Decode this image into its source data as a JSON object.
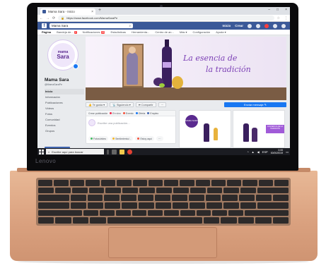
{
  "laptop": {
    "brand": "Lenovo"
  },
  "browser": {
    "tab_title": "Mama Sara - Inicio",
    "tab_close": "×",
    "new_tab": "+",
    "window_controls": [
      "–",
      "□",
      "×"
    ],
    "url": "https://www.facebook.com/MamaSaraPe",
    "nav_icons": [
      "←",
      "→",
      "⟳"
    ]
  },
  "facebook": {
    "logo": "f",
    "search_value": "Mama Sara",
    "right_links": [
      "Inicio",
      "Crear"
    ],
    "page_nav": [
      {
        "label": "Página",
        "active": true
      },
      {
        "label": "Bandeja de...",
        "badge": "2"
      },
      {
        "label": "Notificaciones",
        "badge": "23"
      },
      {
        "label": "Estadísticas"
      },
      {
        "label": "Herramienta..."
      },
      {
        "label": "Centro de an..."
      },
      {
        "label": "Más ▾"
      },
      {
        "label": "Configuración"
      },
      {
        "label": "Ayuda ▾"
      }
    ],
    "profile": {
      "logo_top": "mama",
      "logo_bottom": "Sara",
      "name": "Mama Sara",
      "handle": "@MamaSaraPe"
    },
    "left_nav": [
      "Inicio",
      "Información",
      "Publicaciones",
      "Videos",
      "Fotos",
      "Comunidad",
      "Eventos",
      "Grupos"
    ],
    "promote_label": "Promocionar",
    "cover": {
      "tagline_1": "La esencia de",
      "tagline_2": "la tradición"
    },
    "actions": [
      "👍 Te gusta ▾",
      "📡 Siguiendo ▾",
      "➦ Compartir",
      "···"
    ],
    "send_message": "Enviar mensaje ✎",
    "composer": {
      "tabs": [
        "Crear publicación",
        "En vivo",
        "Evento",
        "Oferta",
        "Empleo"
      ],
      "placeholder": "Escribe una publicación...",
      "chips": [
        "Fotos/video",
        "Sentimiento/...",
        "Estoy aquí",
        "···"
      ]
    },
    "promo_cards": [
      {
        "logo": "MAMA SARA"
      },
      {
        "band": "LA ESENCIA DE LA TRADICIÓN"
      }
    ]
  },
  "taskbar": {
    "search_placeholder": "Escribe aquí para buscar",
    "time": "0:00",
    "date": "00/00/2019",
    "lang": "ESP"
  },
  "colors": {
    "fb_blue": "#3b5998",
    "brand_purple": "#7b3fb5",
    "laptop_copper": "#d9a07e"
  }
}
